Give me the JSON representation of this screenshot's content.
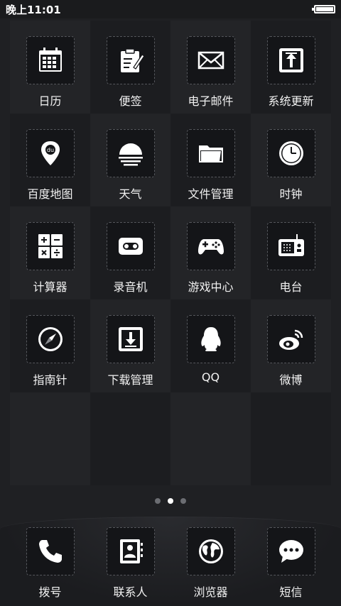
{
  "status_bar": {
    "time": "晚上11:01",
    "battery_level": 1.0
  },
  "apps": [
    {
      "label": "日历",
      "icon": "calendar-icon"
    },
    {
      "label": "便签",
      "icon": "notepad-icon"
    },
    {
      "label": "电子邮件",
      "icon": "mail-icon"
    },
    {
      "label": "系统更新",
      "icon": "update-icon"
    },
    {
      "label": "百度地图",
      "icon": "map-pin-icon",
      "icon_text": "du"
    },
    {
      "label": "天气",
      "icon": "weather-icon"
    },
    {
      "label": "文件管理",
      "icon": "folder-icon"
    },
    {
      "label": "时钟",
      "icon": "clock-icon"
    },
    {
      "label": "计算器",
      "icon": "calculator-icon"
    },
    {
      "label": "录音机",
      "icon": "recorder-icon"
    },
    {
      "label": "游戏中心",
      "icon": "gamepad-icon"
    },
    {
      "label": "电台",
      "icon": "radio-icon"
    },
    {
      "label": "指南针",
      "icon": "compass-icon"
    },
    {
      "label": "下载管理",
      "icon": "download-icon"
    },
    {
      "label": "QQ",
      "icon": "qq-icon"
    },
    {
      "label": "微博",
      "icon": "weibo-icon"
    }
  ],
  "page_indicator": {
    "count": 3,
    "active": 1
  },
  "dock": [
    {
      "label": "拨号",
      "icon": "phone-icon"
    },
    {
      "label": "联系人",
      "icon": "contacts-icon"
    },
    {
      "label": "浏览器",
      "icon": "globe-icon"
    },
    {
      "label": "短信",
      "icon": "message-icon"
    }
  ]
}
